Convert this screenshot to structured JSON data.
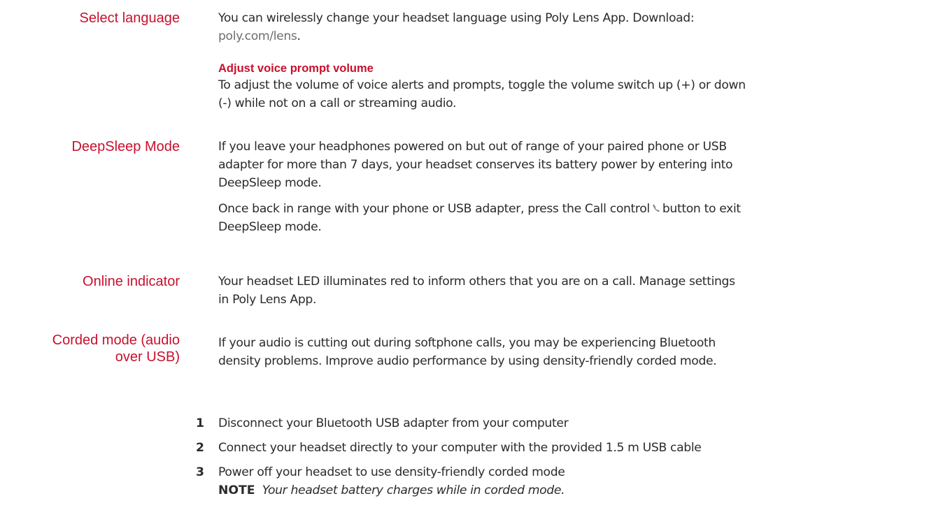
{
  "sections": {
    "select_language": {
      "heading": "Select language",
      "text_before_link": "You can wirelessly change your headset language using Poly Lens App. Download:",
      "link": "poly.com/lens",
      "text_after_link": "."
    },
    "voice_prompt": {
      "subheading": "Adjust voice prompt volume",
      "text_line1": "To adjust the volume of voice alerts and prompts, toggle the volume switch up (+) or down",
      "text_line2": "(-) while not on a call or streaming audio."
    },
    "deepsleep": {
      "heading": "DeepSleep Mode",
      "para1_line1": "If you leave your headphones powered on but out of range of your paired phone or USB",
      "para1_line2": "adapter for more than 7 days, your headset conserves its battery power by entering into",
      "para1_line3": "DeepSleep mode.",
      "para2_before_icon": "Once back in range with your phone or USB adapter, press the Call control",
      "para2_after_icon": "button to exit",
      "para2_line2": "DeepSleep mode.",
      "icon": "phone-icon"
    },
    "online_indicator": {
      "heading": "Online indicator",
      "line1": "Your headset LED illuminates red to inform others that you are on a call. Manage settings",
      "line2": "in Poly Lens App."
    },
    "corded_mode": {
      "heading_line1": "Corded mode (audio",
      "heading_line2": "over USB)",
      "line1": "If your audio is cutting out during softphone calls, you may be experiencing Bluetooth",
      "line2": "density problems. Improve audio performance by using density-friendly corded mode.",
      "steps": [
        {
          "num": "1",
          "text": "Disconnect your Bluetooth USB adapter from your computer"
        },
        {
          "num": "2",
          "text": "Connect your headset directly to your computer with the provided 1.5 m USB cable"
        },
        {
          "num": "3",
          "text": "Power off your headset to use density-friendly corded mode"
        }
      ],
      "note_label": "NOTE",
      "note_text": "Your headset battery charges while in corded mode."
    }
  },
  "colors": {
    "heading_red": "#c8102e",
    "body_text": "#2b2b2b",
    "link_gray": "#6e6e6e"
  }
}
